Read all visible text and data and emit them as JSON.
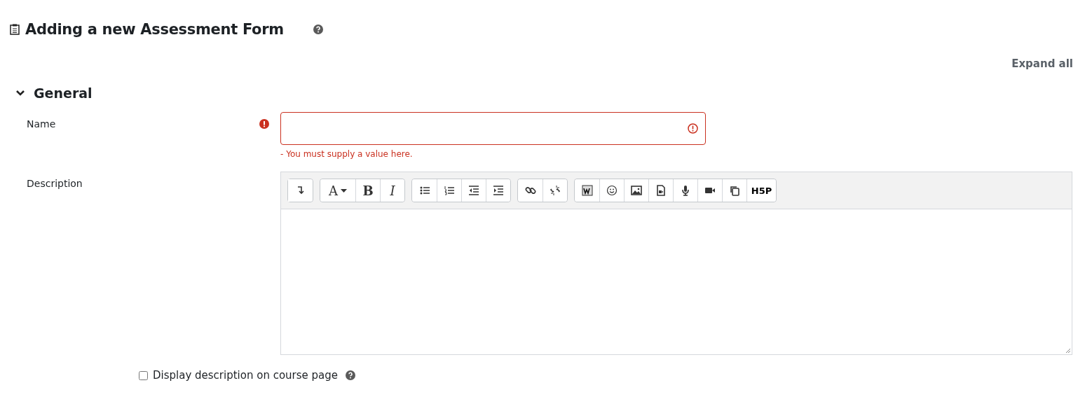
{
  "page_title": "Adding a new Assessment Form",
  "expand_all": "Expand all",
  "section": {
    "title": "General",
    "expanded": true
  },
  "name_field": {
    "label": "Name",
    "required": true,
    "error": "- You must supply a value here."
  },
  "description": {
    "label": "Description",
    "toolbar": [
      [
        {
          "kind": "icon"
        }
      ],
      [
        {
          "kind": "font",
          "label": "A"
        },
        {
          "kind": "bold",
          "label": "B"
        },
        {
          "kind": "italic",
          "label": "I"
        }
      ],
      [
        {
          "kind": "icon"
        },
        {
          "kind": "icon"
        },
        {
          "kind": "icon"
        },
        {
          "kind": "icon"
        }
      ],
      [
        {
          "kind": "icon"
        },
        {
          "kind": "icon"
        }
      ],
      [
        {
          "kind": "icon"
        },
        {
          "kind": "icon"
        },
        {
          "kind": "icon"
        },
        {
          "kind": "icon"
        },
        {
          "kind": "icon"
        },
        {
          "kind": "icon"
        },
        {
          "kind": "icon"
        },
        {
          "kind": "logo",
          "label": "H5P"
        }
      ]
    ]
  },
  "display_on_course": {
    "label": "Display description on course page",
    "checked": false
  }
}
